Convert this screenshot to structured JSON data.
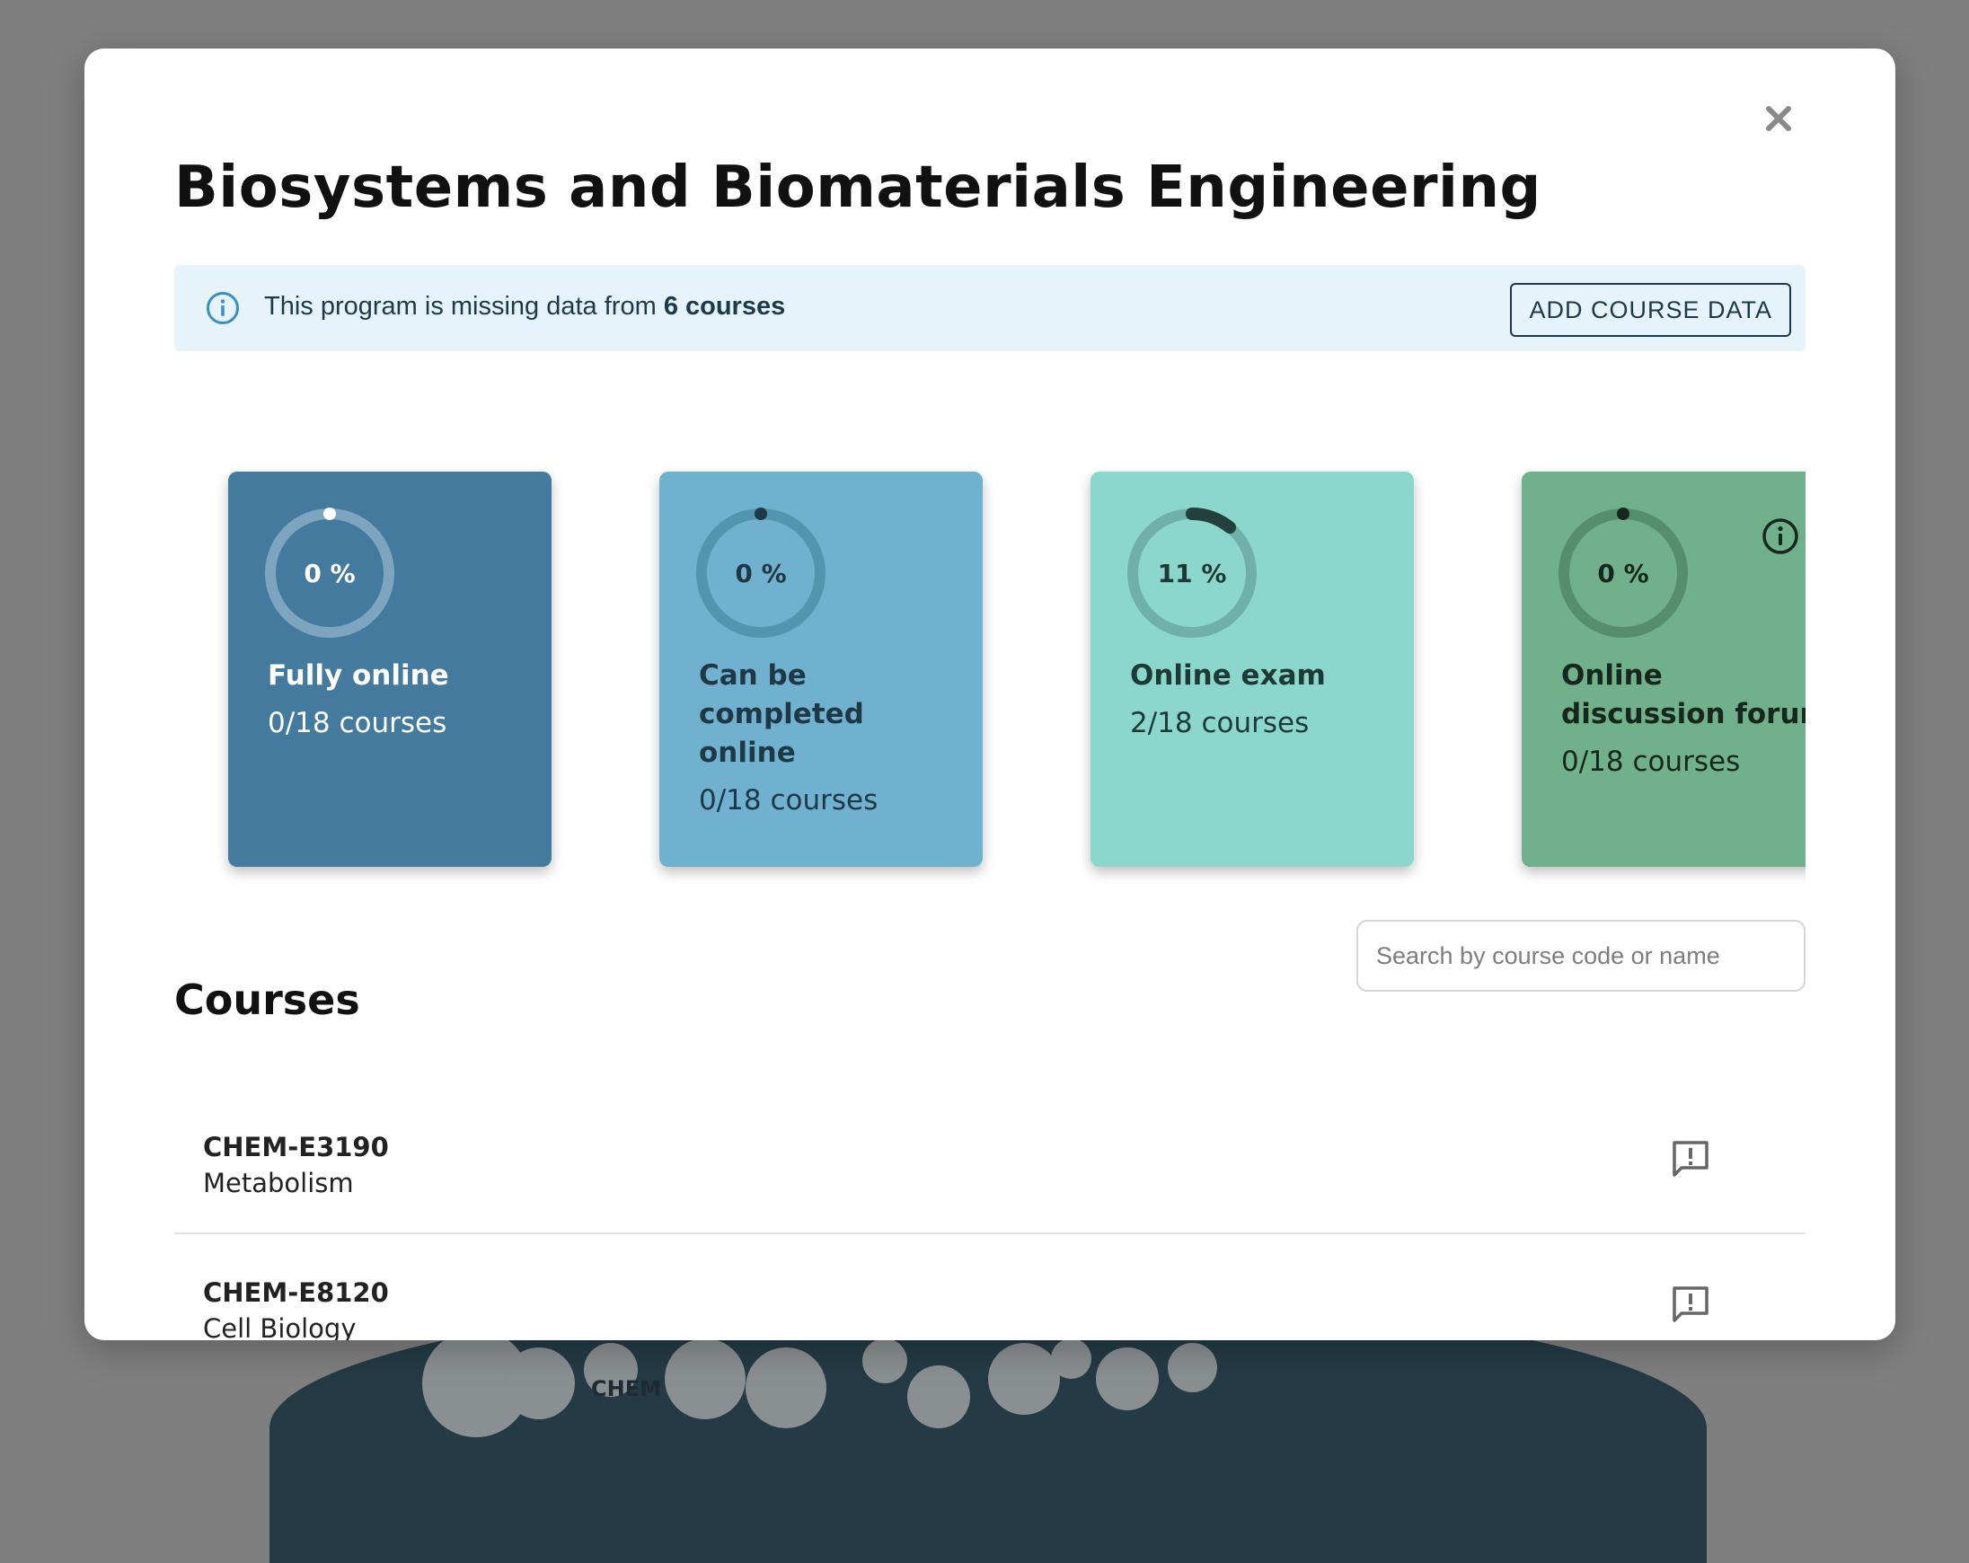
{
  "modal": {
    "title": "Biosystems and Biomaterials Engineering",
    "close_icon": "close-icon"
  },
  "alert": {
    "text_prefix": "This program is missing data from",
    "missing_count": "6 courses",
    "button_label": "ADD COURSE DATA",
    "icon": "info-icon"
  },
  "cards": [
    {
      "percent_label": "0 %",
      "percent": 0,
      "title": "Fully online",
      "count": "0/18 courses",
      "bg": "#437a9e",
      "text_color": "#ffffff",
      "track": "#7ea5c0",
      "progress": "#ffffff"
    },
    {
      "percent_label": "0 %",
      "percent": 0,
      "title": "Can be completed online",
      "count": "0/18 courses",
      "bg": "#70b1cf",
      "text_color": "#1f3845",
      "track": "#5394ae",
      "progress": "#1f3845"
    },
    {
      "percent_label": "11 %",
      "percent": 11,
      "title": "Online exam",
      "count": "2/18 courses",
      "bg": "#8cd7cb",
      "text_color": "#1e3a36",
      "track": "#6fb1a6",
      "progress": "#24403c"
    },
    {
      "percent_label": "0 %",
      "percent": 0,
      "title": "Online discussion forum",
      "count": "0/18 courses",
      "bg": "#70b08a",
      "text_color": "#16281e",
      "track": "#568e6c",
      "progress": "#16281e",
      "has_info": true
    }
  ],
  "courses_section": {
    "title": "Courses",
    "search_placeholder": "Search by course code or name"
  },
  "courses": [
    {
      "code": "CHEM-E3190",
      "name": "Metabolism",
      "action_icon": "feedback-icon"
    },
    {
      "code": "CHEM-E8120",
      "name": "Cell Biology",
      "action_icon": "feedback-icon"
    }
  ],
  "background": {
    "label": "CHEM"
  }
}
